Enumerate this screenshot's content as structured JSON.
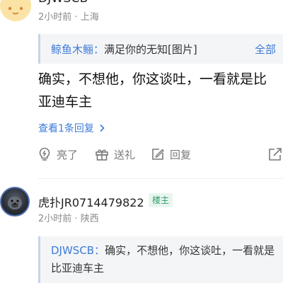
{
  "comment1": {
    "username": "DJWSCB",
    "time": "2小时前",
    "location": "上海",
    "quote_author": "鲸鱼木鲡：",
    "quote_text": "满足你的无知[图片]",
    "quote_all": "全部",
    "text": "确实，不想他，你这谈吐，一看就是比亚迪车主",
    "replies_link": "查看1条回复",
    "actions": {
      "like": "亮了",
      "gift": "送礼",
      "reply": "回复"
    }
  },
  "comment2": {
    "username": "虎扑JR0714479822",
    "badge": "楼主",
    "time": "2小时前",
    "location": "陕西",
    "quote_author": "DJWSCB：",
    "quote_text": "确实，不想他，你这谈吐，一看就是比亚迪车主"
  },
  "colors": {
    "link_blue": "#3d7bd8",
    "badge_green": "#2f9b69",
    "meta_gray": "#8a8a8a"
  },
  "icons": [
    "lightbulb-icon",
    "gift-icon",
    "edit-reply-icon",
    "share-icon",
    "chevron-right-icon"
  ]
}
